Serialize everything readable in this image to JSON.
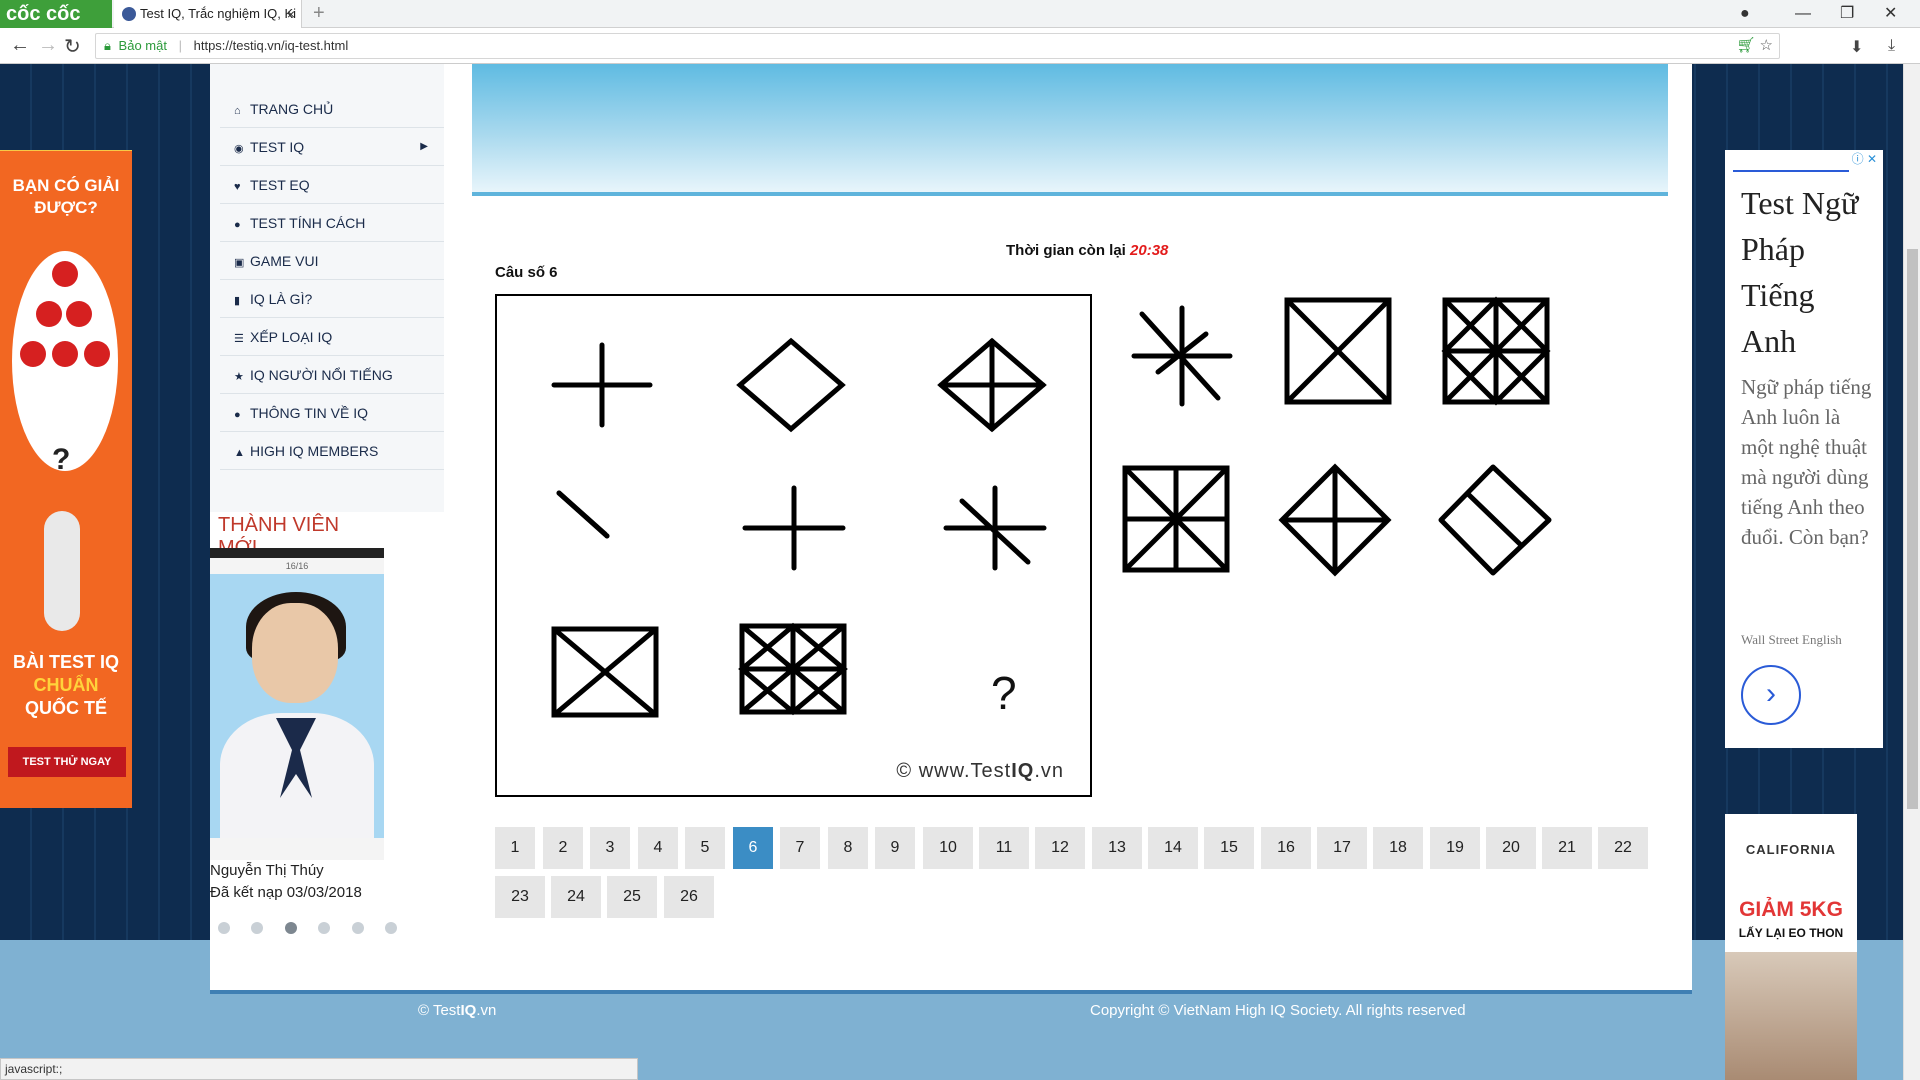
{
  "browser": {
    "logo_label": "cốc cốc",
    "tab_title": "Test IQ, Trắc nghiệm IQ, Ki",
    "tab_close": "×",
    "new_tab": "+",
    "secure_label": "Bảo mật",
    "url": "https://testiq.vn/iq-test.html"
  },
  "menu": {
    "items": [
      {
        "label": "TRANG CHỦ",
        "icon": "home-icon"
      },
      {
        "label": "TEST IQ",
        "icon": "brain-icon"
      },
      {
        "label": "TEST EQ",
        "icon": "heart-icon"
      },
      {
        "label": "TEST TÍNH CÁCH",
        "icon": "people-icon"
      },
      {
        "label": "GAME VUI",
        "icon": "gamepad-icon"
      },
      {
        "label": "IQ LÀ GÌ?",
        "icon": "book-icon"
      },
      {
        "label": "XẾP LOẠI IQ",
        "icon": "list-icon"
      },
      {
        "label": "IQ NGƯỜI NỔI TIẾNG",
        "icon": "star-icon"
      },
      {
        "label": "THÔNG TIN VỀ IQ",
        "icon": "info-icon"
      },
      {
        "label": "HIGH IQ MEMBERS",
        "icon": "group-icon"
      }
    ]
  },
  "members": {
    "title": "THÀNH VIÊN MỚI",
    "phone_header": "16/16",
    "name": "Nguyễn Thị Thúy",
    "joined": "Đã kết nạp 03/03/2018",
    "dot_count": 6,
    "active_dot": 3
  },
  "left_ad": {
    "question": "BẠN CÓ GIẢI ĐƯỢC?",
    "qmark": "?",
    "title_line1": "BÀI TEST IQ",
    "title_line2": "CHUẨN",
    "title_line3": "QUỐC TẾ",
    "button": "TEST THỬ NGAY"
  },
  "quiz": {
    "timer_label": "Thời gian còn lại",
    "timer_value": "20:38",
    "question_label": "Câu số 6",
    "missing_mark": "?",
    "watermark_prefix": "© www.Test",
    "watermark_bold": "IQ",
    "watermark_suffix": ".vn",
    "answers": [
      "star-8-lines",
      "square-x",
      "square-grid-x",
      "square-grid-x-2",
      "diamond-cross",
      "diamond-slash"
    ]
  },
  "pagination": {
    "pages": [
      "1",
      "2",
      "3",
      "4",
      "5",
      "6",
      "7",
      "8",
      "9",
      "10",
      "11",
      "12",
      "13",
      "14",
      "15",
      "16",
      "17",
      "18",
      "19",
      "20",
      "21",
      "22",
      "23",
      "24",
      "25",
      "26"
    ],
    "current": "6"
  },
  "right_ad": {
    "headline": "Test Ngữ Pháp Tiếng Anh",
    "body": "Ngữ pháp tiếng Anh luôn là một nghệ thuật mà người dùng tiếng Anh theo đuổi. Còn bạn?",
    "brand": "Wall Street English",
    "arrow": "›",
    "badge": "ⓘ ✕"
  },
  "right_ad2": {
    "brand": "CALIFORNIA",
    "promo": "GIẢM 5KG",
    "promo2": "LẤY LẠI EO THON"
  },
  "footer": {
    "left_prefix": "© Test",
    "left_bold": "IQ",
    "left_suffix": ".vn",
    "right": "Copyright © VietNam High IQ Society. All rights reserved"
  },
  "status_bar": "javascript:;",
  "colors": {
    "accent": "#3b8dc5",
    "timer": "#e31b1b",
    "member_title": "#c0392b"
  }
}
